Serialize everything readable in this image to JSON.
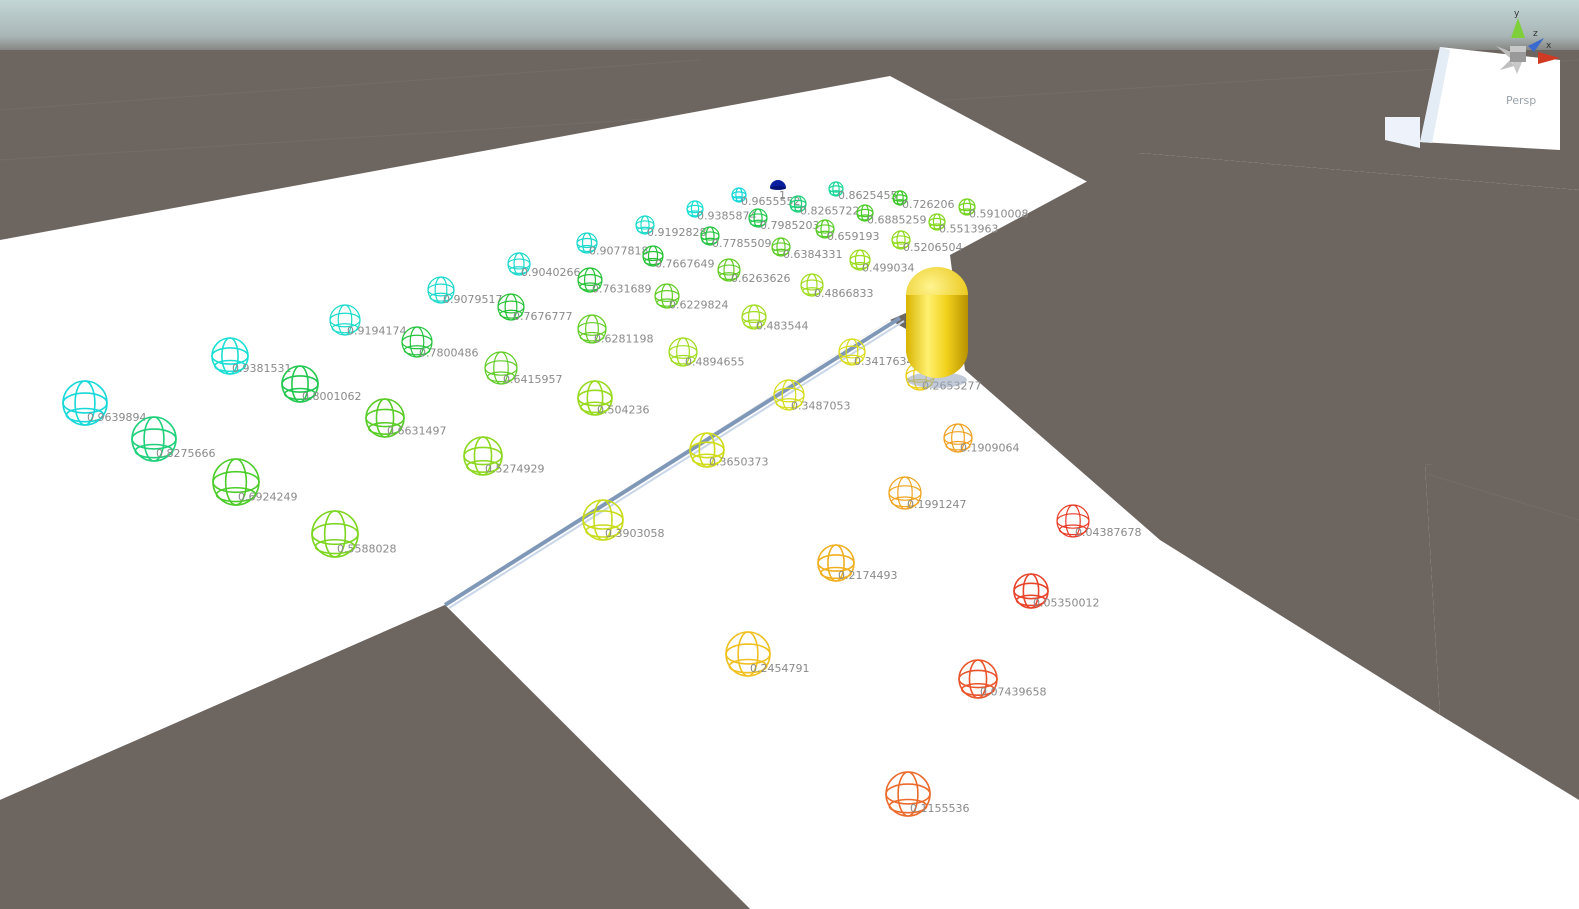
{
  "viewport": {
    "projection_label": "Persp",
    "axis_labels": {
      "x": "x",
      "y": "y",
      "z": "z"
    }
  },
  "colors": {
    "sky_top": "#c3d6d6",
    "ground": "#6d6560",
    "floor": "#ffffff",
    "capsule": "#f2d21c",
    "goal_marker": "#0a1fa0",
    "label_text": "#8a8a8a"
  },
  "goal_marker": {
    "label": "1"
  },
  "waypoints": [
    {
      "id": 1,
      "value": "0.9655552",
      "color": "#17d8d8"
    },
    {
      "id": 2,
      "value": "0.9385874",
      "color": "#1adfd4"
    },
    {
      "id": 3,
      "value": "0.9192828",
      "color": "#1cdccc"
    },
    {
      "id": 4,
      "value": "0.9077818",
      "color": "#1cd9cc"
    },
    {
      "id": 5,
      "value": "0.9040266",
      "color": "#1cd9cc"
    },
    {
      "id": 6,
      "value": "0.9079517",
      "color": "#1cd9cc"
    },
    {
      "id": 7,
      "value": "0.9194174",
      "color": "#1cdccc"
    },
    {
      "id": 8,
      "value": "0.9381531",
      "color": "#1adfd4"
    },
    {
      "id": 9,
      "value": "0.9639894",
      "color": "#17d8d8"
    },
    {
      "id": 10,
      "value": "0.8625455",
      "color": "#1ed79a"
    },
    {
      "id": 11,
      "value": "0.8265722",
      "color": "#1ed07a"
    },
    {
      "id": 12,
      "value": "0.7985203",
      "color": "#22c84e"
    },
    {
      "id": 13,
      "value": "0.7785509",
      "color": "#24c43e"
    },
    {
      "id": 14,
      "value": "0.7667649",
      "color": "#26c236"
    },
    {
      "id": 15,
      "value": "0.7631689",
      "color": "#26c236"
    },
    {
      "id": 16,
      "value": "0.7676777",
      "color": "#26c236"
    },
    {
      "id": 17,
      "value": "0.7800486",
      "color": "#24c43e"
    },
    {
      "id": 18,
      "value": "0.8001062",
      "color": "#22c84e"
    },
    {
      "id": 19,
      "value": "0.8275666",
      "color": "#1ed07a"
    },
    {
      "id": 20,
      "value": "0.726206",
      "color": "#3dc82a"
    },
    {
      "id": 21,
      "value": "0.6885259",
      "color": "#4ccc28"
    },
    {
      "id": 22,
      "value": "0.659193",
      "color": "#58cc26"
    },
    {
      "id": 23,
      "value": "0.6384331",
      "color": "#5ecc24"
    },
    {
      "id": 24,
      "value": "0.6263626",
      "color": "#62cc24"
    },
    {
      "id": 25,
      "value": "0.6229824",
      "color": "#62cc24"
    },
    {
      "id": 26,
      "value": "0.6281198",
      "color": "#62cc24"
    },
    {
      "id": 27,
      "value": "0.6415957",
      "color": "#5ecc24"
    },
    {
      "id": 28,
      "value": "0.6631497",
      "color": "#58cc26"
    },
    {
      "id": 29,
      "value": "0.6924249",
      "color": "#4ccc28"
    },
    {
      "id": 30,
      "value": "0.5910008",
      "color": "#74d420"
    },
    {
      "id": 31,
      "value": "0.5513963",
      "color": "#84d820"
    },
    {
      "id": 32,
      "value": "0.5206504",
      "color": "#90da1e"
    },
    {
      "id": 33,
      "value": "0.499034",
      "color": "#9adc1e"
    },
    {
      "id": 34,
      "value": "0.4866833",
      "color": "#a0dc1e"
    },
    {
      "id": 35,
      "value": "0.483544",
      "color": "#a2dc1e"
    },
    {
      "id": 36,
      "value": "0.4894655",
      "color": "#a0dc1e"
    },
    {
      "id": 37,
      "value": "0.504236",
      "color": "#98da1e"
    },
    {
      "id": 38,
      "value": "0.5274929",
      "color": "#8cd81e"
    },
    {
      "id": 39,
      "value": "0.5588028",
      "color": "#7cd620"
    },
    {
      "id": 40,
      "value": "0.3417634",
      "color": "#d8dc1a"
    },
    {
      "id": 41,
      "value": "0.2653277",
      "color": "#eecc10"
    },
    {
      "id": 42,
      "value": "0.3487053",
      "color": "#d4dc1a"
    },
    {
      "id": 43,
      "value": "0.3650373",
      "color": "#d0dc1a"
    },
    {
      "id": 44,
      "value": "0.3903058",
      "color": "#c8dc1c"
    },
    {
      "id": 45,
      "value": "0.1909064",
      "color": "#f0a020"
    },
    {
      "id": 46,
      "value": "0.1991247",
      "color": "#f0a420"
    },
    {
      "id": 47,
      "value": "0.2174493",
      "color": "#f0b020"
    },
    {
      "id": 48,
      "value": "0.2454791",
      "color": "#f0c020"
    },
    {
      "id": 49,
      "value": "0.04387678",
      "color": "#e83c28"
    },
    {
      "id": 50,
      "value": "0.05350012",
      "color": "#e8442a"
    },
    {
      "id": 51,
      "value": "0.07439658",
      "color": "#ea542a"
    },
    {
      "id": 52,
      "value": "0.1155536",
      "color": "#ec6a2a"
    }
  ]
}
